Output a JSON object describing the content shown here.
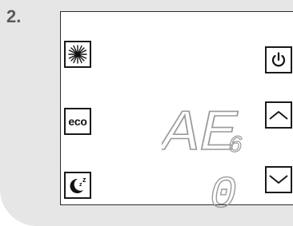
{
  "step_label": "2.",
  "buttons": {
    "snowflake": {
      "icon": "snowflake-icon"
    },
    "eco": {
      "label": "eco"
    },
    "sleep": {
      "icon": "moon-sleep-icon",
      "z_small": "z",
      "z_large": "z"
    },
    "power": {
      "icon": "power-icon"
    },
    "up": {
      "icon": "chevron-up-icon"
    },
    "down": {
      "icon": "chevron-down-icon"
    }
  },
  "display": {
    "main_text": "AE",
    "sub_text": "6",
    "bottom_text": "0",
    "segment_color": "#9a9a9a"
  },
  "colors": {
    "background": "#e6e6e6",
    "device_border": "#2b2b2b",
    "button_border": "#1a1a1a",
    "step_text": "#5a5a5a"
  }
}
